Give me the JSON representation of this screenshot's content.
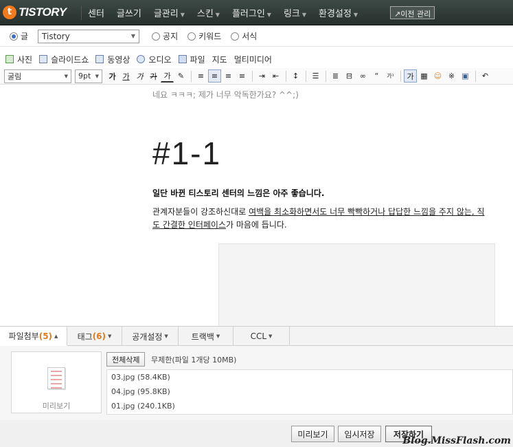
{
  "topbar": {
    "logo_icon": "t-logo-icon",
    "logo_text": "TISTORY",
    "nav": [
      {
        "label": "센터",
        "dropdown": false
      },
      {
        "label": "글쓰기",
        "dropdown": false
      },
      {
        "label": "글관리",
        "dropdown": true
      },
      {
        "label": "스킨",
        "dropdown": true
      },
      {
        "label": "플러그인",
        "dropdown": true
      },
      {
        "label": "링크",
        "dropdown": true
      },
      {
        "label": "환경설정",
        "dropdown": true
      }
    ],
    "old_admin": "↗이전 관리"
  },
  "post_type": {
    "options": [
      "글",
      "공지",
      "키워드",
      "서식"
    ],
    "selected": "글",
    "category": "Tistory"
  },
  "media_toolbar": [
    "사진",
    "슬라이드쇼",
    "동영상",
    "오디오",
    "파일",
    "지도",
    "멀티미디어"
  ],
  "format_toolbar": {
    "font": "굴림",
    "size": "9pt",
    "buttons": [
      "가",
      "가",
      "가",
      "가",
      "가",
      "✎",
      "≡",
      "≡",
      "≡",
      "≡",
      "⇥",
      "⇤",
      "↕",
      "☰",
      "≣",
      "⊟",
      "∞",
      "“",
      "가¹",
      "가",
      "▦",
      "☺",
      "※",
      "▣",
      "↶"
    ]
  },
  "editor": {
    "previous_line": "네요 ㅋㅋㅋ; 제가 너무 악독한가요? ^^;)",
    "heading": "#1-1",
    "bold_line": "일단 바뀐 티스토리 센터의 느낌은 아주 좋습니다.",
    "para_part1": "관계자분들이 강조하신대로 ",
    "para_underlined1": "여백을 최소화하면서도 너무 빡빡하거나 답답한 느낌을 주지 않는, 직",
    "para_underlined2": "도 간결한 인터페이스",
    "para_part2": "가 마음에 듭니다."
  },
  "tabs": [
    {
      "label": "파일첨부",
      "count": "(5)",
      "active": true
    },
    {
      "label": "태그",
      "count": "(6)",
      "active": false
    },
    {
      "label": "공개설정",
      "count": "",
      "active": false
    },
    {
      "label": "트랙백",
      "count": "",
      "active": false
    },
    {
      "label": "CCL",
      "count": "",
      "active": false
    }
  ],
  "attachment": {
    "preview_label": "미리보기",
    "delete_all": "전체삭제",
    "limit_text": "무제한(파일 1개당 10MB)",
    "files": [
      "03.jpg (58.4KB)",
      "04.jpg (95.8KB)",
      "01.jpg (240.1KB)"
    ]
  },
  "actions": {
    "preview": "미리보기",
    "temp_save": "임시저장",
    "save": "저장하기"
  },
  "watermark": "Blog.MissFlash.com",
  "colors": {
    "topbar": "#2c3633",
    "tab_count": "#e07a1a",
    "radio_selected": "#3a6fc4"
  }
}
